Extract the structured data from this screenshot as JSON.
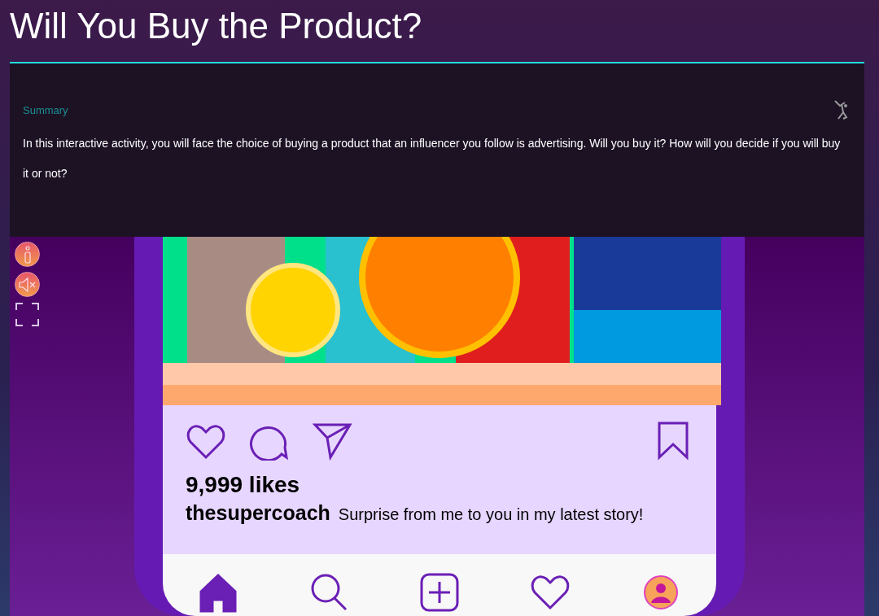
{
  "title": "Will You Buy the Product?",
  "summary": {
    "heading": "Summary",
    "text": "In this interactive activity, you will face the choice of buying a product that an influencer you follow is advertising. Will you buy it? How will you decide if you will buy it or not?"
  },
  "side_controls": [
    {
      "kind": "info"
    },
    {
      "kind": "mute"
    },
    {
      "kind": "fullscreen"
    }
  ],
  "post": {
    "actions": [
      {
        "kind": "like"
      },
      {
        "kind": "comment"
      },
      {
        "kind": "share"
      },
      {
        "kind": "save"
      }
    ],
    "likes": "9,999 likes",
    "username": "thesupercoach",
    "caption": "Surprise from me to you in my latest story!"
  },
  "nav": [
    {
      "kind": "home",
      "selected": true
    },
    {
      "kind": "search",
      "selected": false
    },
    {
      "kind": "add",
      "selected": false
    },
    {
      "kind": "heart",
      "selected": false
    },
    {
      "kind": "profile",
      "selected": false
    }
  ]
}
